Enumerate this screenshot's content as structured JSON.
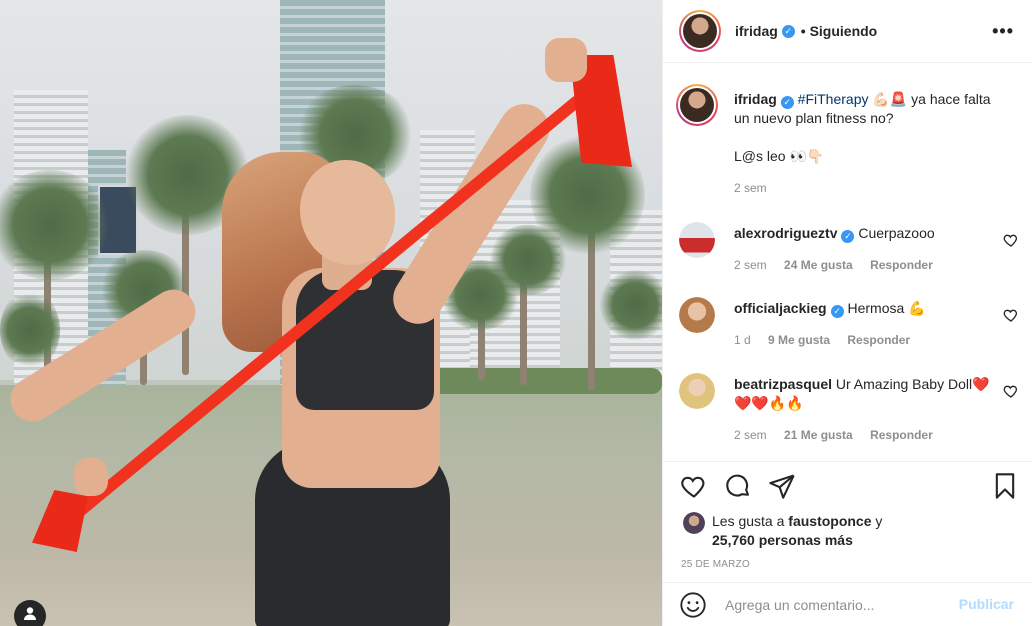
{
  "post": {
    "author": "ifridag",
    "follow_status": "• Siguiendo",
    "date": "25 DE MARZO"
  },
  "caption": {
    "username": "ifridag",
    "hashtag": "#FiTherapy",
    "emoji": "💪🏻🚨",
    "text_line1": " ya hace falta un nuevo plan fitness no?",
    "text_line2": "L@s leo 👀👇🏻",
    "time": "2 sem"
  },
  "comments": [
    {
      "username": "alexrodrigueztv",
      "verified": true,
      "text": "Cuerpazooo",
      "time": "2 sem",
      "likes": "24 Me gusta",
      "reply": "Responder"
    },
    {
      "username": "officialjackieg",
      "verified": true,
      "text": "Hermosa 💪",
      "time": "1 d",
      "likes": "9 Me gusta",
      "reply": "Responder"
    },
    {
      "username": "beatrizpasquel",
      "verified": false,
      "text": "Ur Amazing Baby Doll❤️❤️❤️🔥🔥",
      "time": "2 sem",
      "likes": "21 Me gusta",
      "reply": "Responder"
    }
  ],
  "likes": {
    "prefix": "Les gusta a ",
    "user": "faustoponce",
    "suffix": " y",
    "others": "25,760 personas más"
  },
  "comment_box": {
    "placeholder": "Agrega un comentario...",
    "publish": "Publicar"
  },
  "icons": {
    "verified": "verified-badge",
    "more": "more-options-icon",
    "like": "heart-icon",
    "comment": "comment-bubble-icon",
    "share": "paper-plane-icon",
    "save": "bookmark-icon",
    "emoji": "smiley-icon",
    "tag": "user-tag-icon"
  },
  "colors": {
    "link": "#00376b",
    "verified": "#3897f0",
    "publish_disabled": "#b3dbff",
    "band": "#f0321f"
  }
}
